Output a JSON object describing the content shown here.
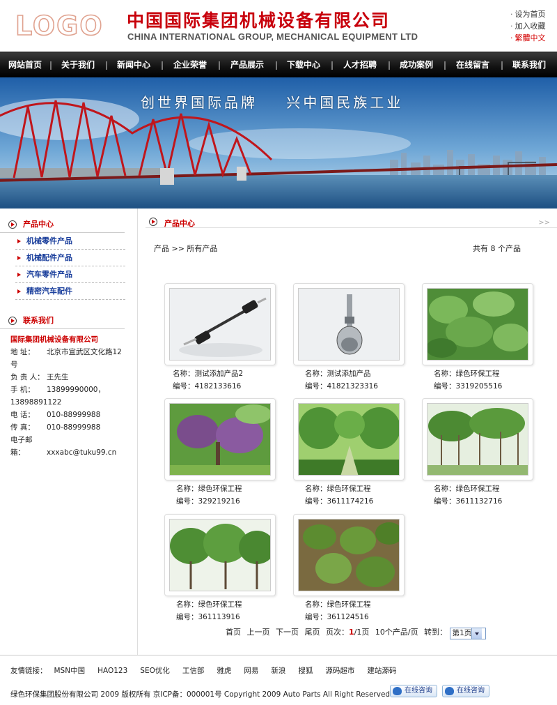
{
  "header": {
    "logo_text": "LOGO",
    "company_cn": "中国国际集团机械设备有限公司",
    "company_en": "CHINA INTERNATIONAL GROUP, MECHANICAL EQUIPMENT LTD",
    "links": [
      "设为首页",
      "加入收藏",
      "繁體中文"
    ]
  },
  "nav": [
    "网站首页",
    "关于我们",
    "新闻中心",
    "企业荣誉",
    "产品展示",
    "下载中心",
    "人才招聘",
    "成功案例",
    "在线留言",
    "联系我们"
  ],
  "banner": {
    "slogan": "创世界国际品牌    兴中国民族工业"
  },
  "sidebar": {
    "products_title": "产品中心",
    "categories": [
      "机械零件产品",
      "机械配件产品",
      "汽车零件产品",
      "精密汽车配件"
    ],
    "contact_title": "联系我们",
    "contact": {
      "company": "国际集团机械设备有限公司",
      "address_label": "地    址：",
      "address": "北京市宣武区文化路12号",
      "person_label": "负 责 人：",
      "person": "王先生",
      "mobile_label": "手    机：",
      "mobile": "13899990000，13898891122",
      "phone_label": "电    话：",
      "phone": "010-88999988",
      "fax_label": "传    真：",
      "fax": "010-88999988",
      "email_label": "电子邮箱：",
      "email": "xxxabc@tuku99.cn"
    }
  },
  "main": {
    "title": "产品中心",
    "more": ">>",
    "crumb": "产品  >>  所有产品",
    "count": "共有 8 个产品",
    "products": [
      {
        "name": "名称：测试添加产品2",
        "code": "编号：4182133616",
        "image": "axle-shaft-photo"
      },
      {
        "name": "名称：测试添加产品",
        "code": "编号：41821323316",
        "image": "cv-joint-photo"
      },
      {
        "name": "名称：绿色环保工程",
        "code": "编号：3319205516",
        "image": "leaves-photo"
      },
      {
        "name": "名称：绿色环保工程",
        "code": "编号：329219216",
        "image": "flowering-tree-photo"
      },
      {
        "name": "名称：绿色环保工程",
        "code": "编号：3611174216",
        "image": "tree-lined-road-photo"
      },
      {
        "name": "名称：绿色环保工程",
        "code": "编号：3611132716",
        "image": "tree-nursery-photo"
      },
      {
        "name": "名称：绿色环保工程",
        "code": "编号：361113916",
        "image": "tree-row-photo"
      },
      {
        "name": "名称：绿色环保工程",
        "code": "编号：361124516",
        "image": "catalpa-leaves-photo"
      }
    ],
    "pager": {
      "first": "首页",
      "prev": "上一页",
      "next": "下一页",
      "last": "尾页",
      "page_label": "页次：",
      "page_current": "1",
      "page_total": "/1页",
      "per_page": "10个产品/页",
      "goto": "转到：",
      "select_value": "第1页"
    }
  },
  "footer": {
    "links_label": "友情链接：",
    "links": [
      "MSN中国",
      "HAO123",
      "SEO优化",
      "工信部",
      "雅虎",
      "网易",
      "新浪",
      "搜狐",
      "源码超市",
      "建站源码"
    ],
    "copyright": "绿色环保集团股份有限公司 2009 版权所有 京ICP备：000001号 Copyright 2009 Auto Parts All Right Reserved",
    "chat_buttons": [
      "在线咨询",
      "在线咨询"
    ]
  },
  "colors": {
    "accent_red": "#c8000c",
    "nav_bg": "#111111",
    "link_blue": "#1b3f9c"
  }
}
